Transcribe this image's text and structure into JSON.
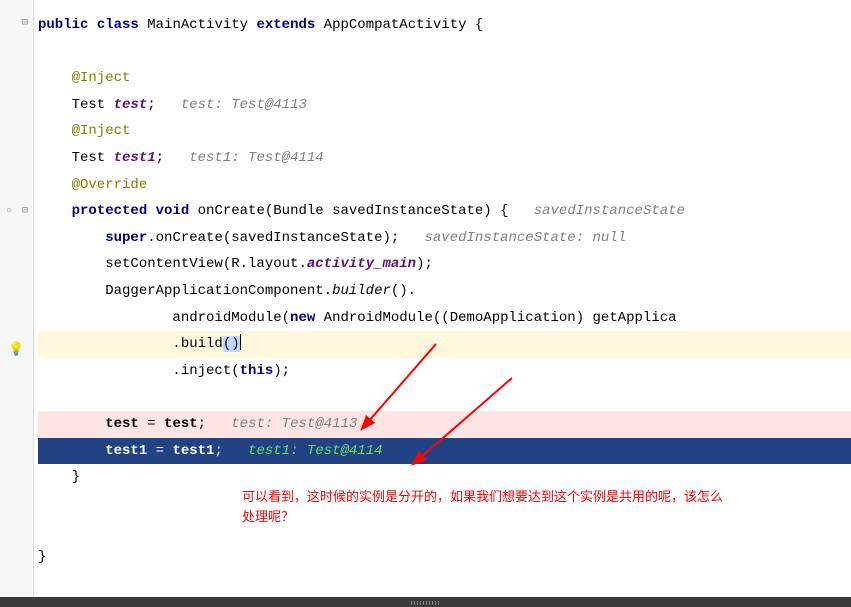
{
  "code": {
    "l01a": "public",
    "l01b": " ",
    "l01c": "class",
    "l01d": " MainActivity ",
    "l01e": "extends",
    "l01f": " AppCompatActivity {",
    "l03": "    @Inject",
    "l04a": "    Test ",
    "l04b": "test",
    "l04c": ";",
    "l04d": "   test: Test@4113",
    "l05": "    @Inject",
    "l06a": "    Test ",
    "l06b": "test1",
    "l06c": ";",
    "l06d": "   test1: Test@4114",
    "l07": "    @Override",
    "l08a": "    ",
    "l08b": "protected",
    "l08c": " ",
    "l08d": "void",
    "l08e": " onCreate(Bundle savedInstanceState) {",
    "l08f": "   savedInstanceState",
    "l09a": "        ",
    "l09b": "super",
    "l09c": ".onCreate(savedInstanceState);",
    "l09d": "   savedInstanceState: null",
    "l10a": "        setContentView(R.layout.",
    "l10b": "activity_main",
    "l10c": ");",
    "l11a": "        DaggerApplicationComponent.",
    "l11b": "builder",
    "l11c": "().",
    "l12a": "                androidModule(",
    "l12b": "new",
    "l12c": " AndroidModule((DemoApplication) getApplica",
    "l13a": "                .build",
    "l13b": "(",
    "l13c": ")",
    "l14": "                .inject(this);",
    "l14kw": "this",
    "l14pre": "                .inject(",
    "l14post": ");",
    "l16a": "        test",
    "l16b": " = ",
    "l16c": "test",
    "l16d": ";",
    "l16e": "   test: Test@4113",
    "l17a": "        test1",
    "l17b": " = ",
    "l17c": "test1",
    "l17d": ";",
    "l17e": "   test1: Test@4114",
    "l18": "    }",
    "l20": "}"
  },
  "note_line1": "可以看到，这时候的实例是分开的，如果我们想要达到这个实例是共用的呢，该怎么",
  "note_line2": "处理呢？"
}
